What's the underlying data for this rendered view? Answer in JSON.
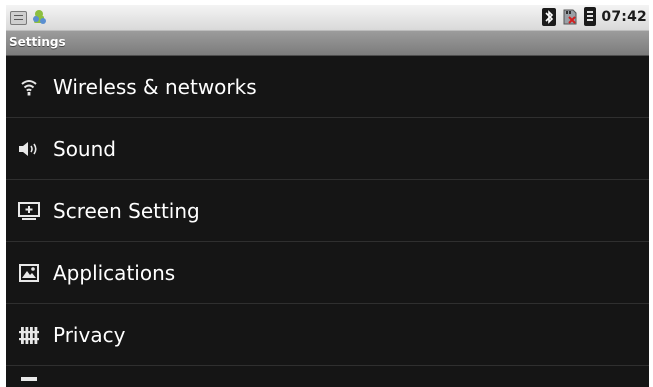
{
  "status_bar": {
    "left_icons": [
      "notification-icon",
      "android-icon"
    ],
    "right_icons": [
      "bluetooth-icon",
      "sd-card-icon",
      "battery-icon"
    ],
    "time": "07:42"
  },
  "title_bar": {
    "title": "Settings"
  },
  "settings_list": {
    "items": [
      {
        "label": "Wireless & networks",
        "icon": "wifi-icon"
      },
      {
        "label": "Sound",
        "icon": "speaker-icon"
      },
      {
        "label": "Screen Setting",
        "icon": "screen-icon"
      },
      {
        "label": "Applications",
        "icon": "applications-icon"
      },
      {
        "label": "Privacy",
        "icon": "privacy-icon"
      }
    ]
  },
  "colors": {
    "list_background": "#151515",
    "divider": "#2f2f2f",
    "title_bar": "#8c8c8c",
    "status_bar": "#e6e6e6",
    "text": "#ffffff"
  }
}
